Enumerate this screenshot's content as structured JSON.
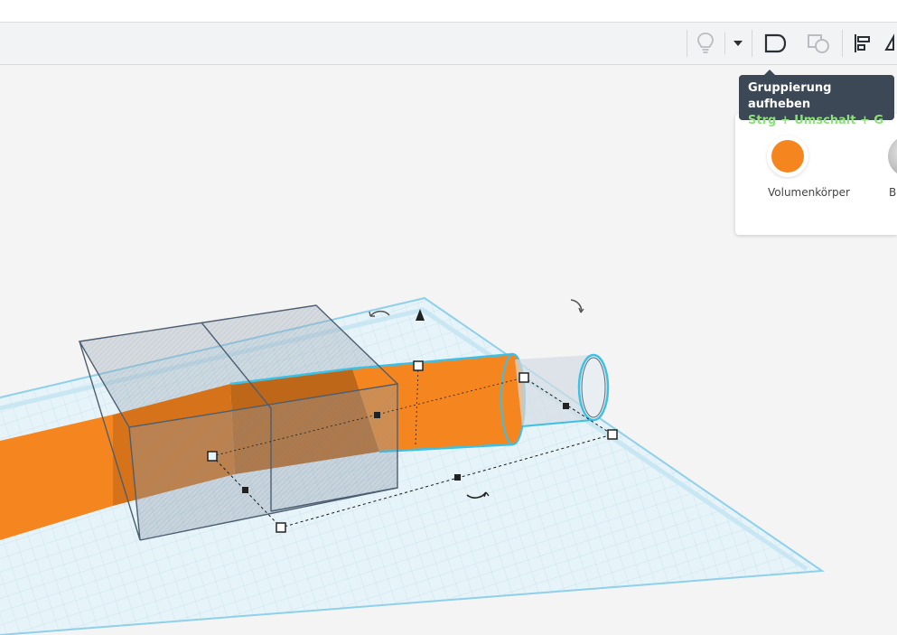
{
  "toolbar": {
    "hint_icon": "lightbulb-icon",
    "group_icon": "group-icon",
    "ungroup_icon": "ungroup-icon",
    "align_icon": "align-icon",
    "mirror_icon": "mirror-icon"
  },
  "tooltip": {
    "title": "Gruppierung aufheben",
    "shortcut": "Strg + Umschalt + G"
  },
  "shape_panel": {
    "solid_label": "Volumenkörper",
    "hole_label_partial": "Bo",
    "solid_color": "#f5861f"
  },
  "colors": {
    "accent_outline": "#3cc0e6",
    "shape_orange": "#f5861f",
    "workplane_bg": "#e6f3f8"
  }
}
